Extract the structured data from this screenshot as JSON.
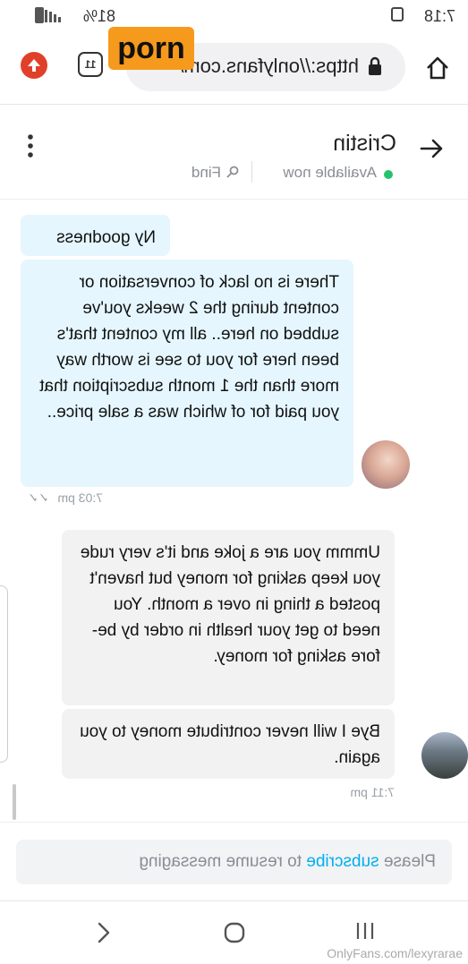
{
  "status_bar": {
    "time": "7:18",
    "battery": "81%"
  },
  "browser": {
    "url": "https://onlyfans.com/",
    "tab_count": "11"
  },
  "overlay": {
    "logo_text": "porn",
    "watermark": "OnlyFans.com/lexyrarae"
  },
  "chat": {
    "contact_name": "Cristin",
    "status": "Available now",
    "find_label": "Find",
    "messages_in": [
      "Ny goodness",
      "There is no lack of conversation or content during the 2 weeks you've subbed on here.. all my content that's been here for you to see is worth way more than the 1 month subscription that you paid for of which was a sale price.."
    ],
    "time_in": "7:03 pm",
    "messages_out": [
      "Ummm you are a joke and it's very rude you keep asking for money but haven't posted a thing in over a month. You need to get your health in order by be-fore asking for money.",
      "Bye I will never contribute money to you again."
    ],
    "time_out": "7:11 pm"
  },
  "composer": {
    "text_before": "Please ",
    "link": "subscribe",
    "text_after": " to resume messaging"
  },
  "colors": {
    "accent": "#00aff0",
    "bubble_in": "#e5f6fe",
    "bubble_out": "#f2f2f2",
    "online": "#25c26e",
    "logo_bg": "#f59a1c"
  }
}
